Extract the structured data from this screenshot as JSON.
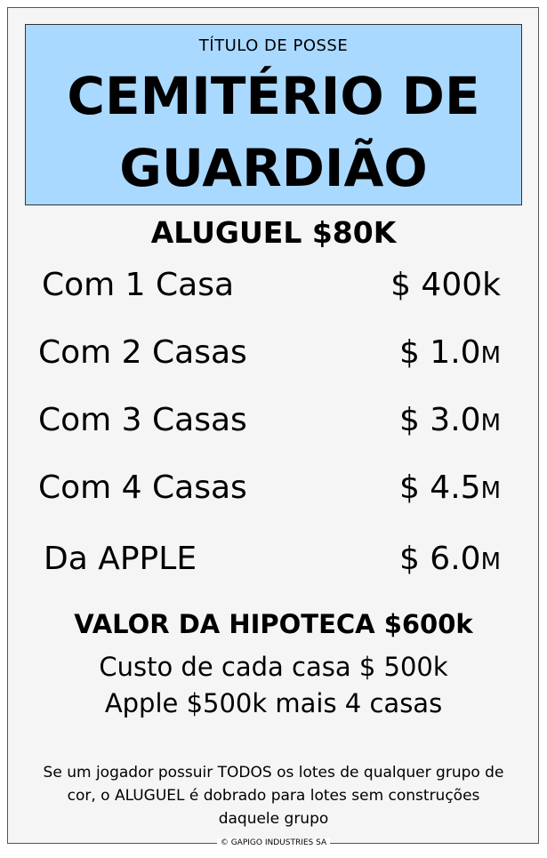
{
  "header": {
    "deed_label": "TÍTULO DE POSSE",
    "property_line1": "CEMITÉRIO DE",
    "property_line2": "GUARDIÃO",
    "color": "#aad9ff"
  },
  "rent": {
    "base": "ALUGUEL $80K"
  },
  "rows": [
    {
      "label": "Com 1 Casa",
      "amount": "$ 400k",
      "unit": ""
    },
    {
      "label": "Com 2 Casas",
      "amount": "$ 1.0",
      "unit": "M"
    },
    {
      "label": "Com 3 Casas",
      "amount": "$ 3.0",
      "unit": "M"
    },
    {
      "label": "Com 4 Casas",
      "amount": "$ 4.5",
      "unit": "M"
    },
    {
      "label": "Da APPLE",
      "amount": "$ 6.0",
      "unit": "M"
    }
  ],
  "mortgage": {
    "label": "VALOR DA HIPOTECA $600k"
  },
  "costs": {
    "house": "Custo de cada casa $ 500k",
    "apple": "Apple $500k mais 4 casas"
  },
  "rule": "Se um jogador possuir TODOS os lotes de qualquer grupo de cor, o ALUGUEL é dobrado para lotes sem construções daquele grupo",
  "copyright": "© GAPIGO INDUSTRIES SA"
}
